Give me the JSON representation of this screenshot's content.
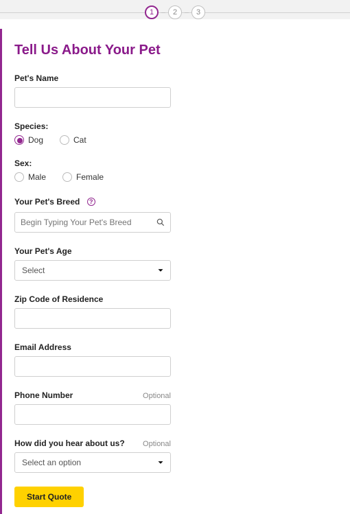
{
  "stepper": {
    "steps": [
      "1",
      "2",
      "3"
    ],
    "activeIndex": 0
  },
  "title": "Tell Us About Your Pet",
  "fields": {
    "petName": {
      "label": "Pet's Name",
      "value": ""
    },
    "species": {
      "label": "Species:",
      "options": [
        "Dog",
        "Cat"
      ],
      "selected": "Dog"
    },
    "sex": {
      "label": "Sex:",
      "options": [
        "Male",
        "Female"
      ],
      "selected": ""
    },
    "breed": {
      "label": "Your Pet's Breed",
      "placeholder": "Begin Typing Your Pet's Breed",
      "value": ""
    },
    "age": {
      "label": "Your Pet's Age",
      "selected": "Select"
    },
    "zip": {
      "label": "Zip Code of Residence",
      "value": ""
    },
    "email": {
      "label": "Email Address",
      "value": ""
    },
    "phone": {
      "label": "Phone Number",
      "optional": "Optional",
      "value": ""
    },
    "hear": {
      "label": "How did you hear about us?",
      "optional": "Optional",
      "selected": "Select an option"
    }
  },
  "submit": {
    "label": "Start Quote"
  }
}
